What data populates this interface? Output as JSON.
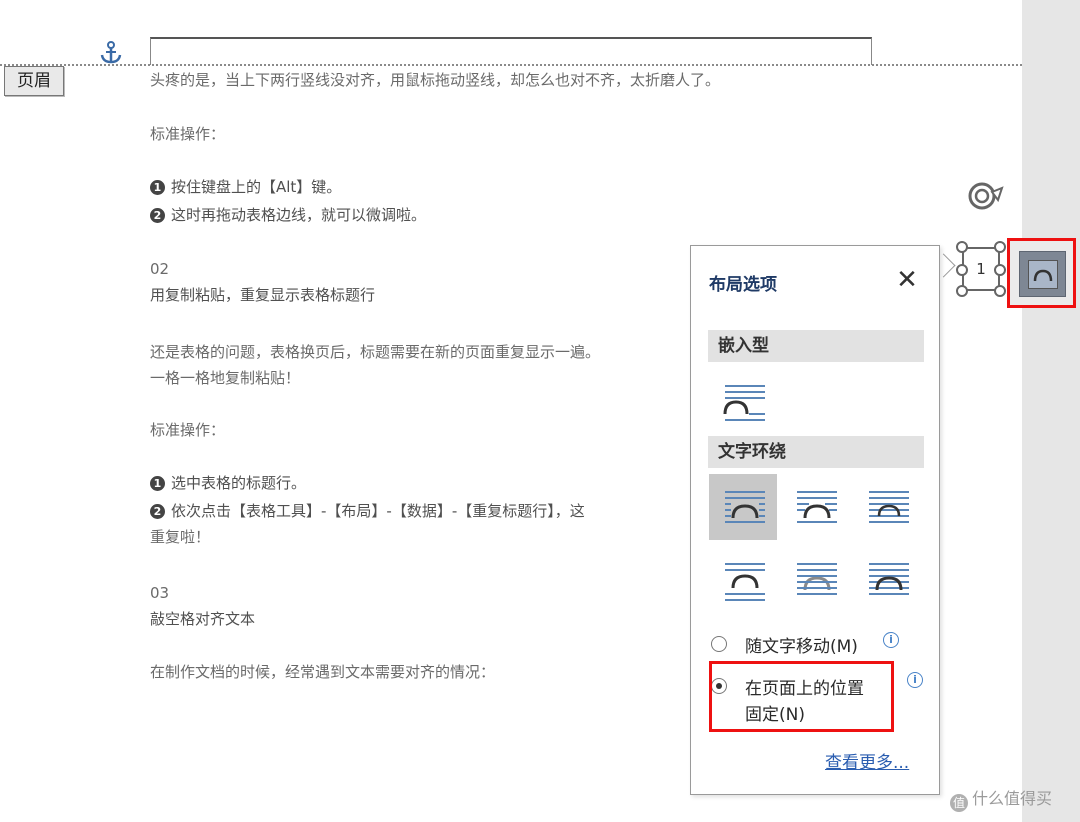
{
  "header": {
    "label": "页眉"
  },
  "document": {
    "lines": [
      "头疼的是，当上下两行竖线没对齐，用鼠标拖动竖线，却怎么也对不齐，太折磨人了。",
      "标准操作：",
      "按住键盘上的【Alt】键。",
      "这时再拖动表格边线，就可以微调啦。",
      "02",
      "用复制粘贴，重复显示表格标题行",
      "还是表格的问题，表格换页后，标题需要在新的页面重复显示一遍。",
      "一格一格地复制粘贴！",
      "标准操作：",
      "选中表格的标题行。",
      "依次点击【表格工具】-【布局】-【数据】-【重复标题行】，这",
      "重复啦！",
      "03",
      "敲空格对齐文本",
      "在制作文档的时候，经常遇到文本需要对齐的情况："
    ],
    "bullets": [
      "❶",
      "❷",
      "❶",
      "❷"
    ]
  },
  "object": {
    "page_number": "1"
  },
  "popup": {
    "title": "布局选项",
    "close_symbol": "✕",
    "inline_section": "嵌入型",
    "wrap_section": "文字环绕",
    "radio_move_with_text": "随文字移动(M)",
    "radio_fixed_line1": "在页面上的位置",
    "radio_fixed_line2": "固定(N)",
    "info_symbol": "i",
    "see_more": "查看更多...",
    "selected_radio": "fixed"
  },
  "watermark": {
    "text": "什么值得买",
    "icon": "值"
  },
  "colors": {
    "highlight": "#ee1111",
    "title": "#1f3a66",
    "link": "#2a5db0"
  },
  "icons": [
    "anchor-icon",
    "rotate-icon",
    "layout-options-icon",
    "close-icon",
    "info-icon"
  ]
}
